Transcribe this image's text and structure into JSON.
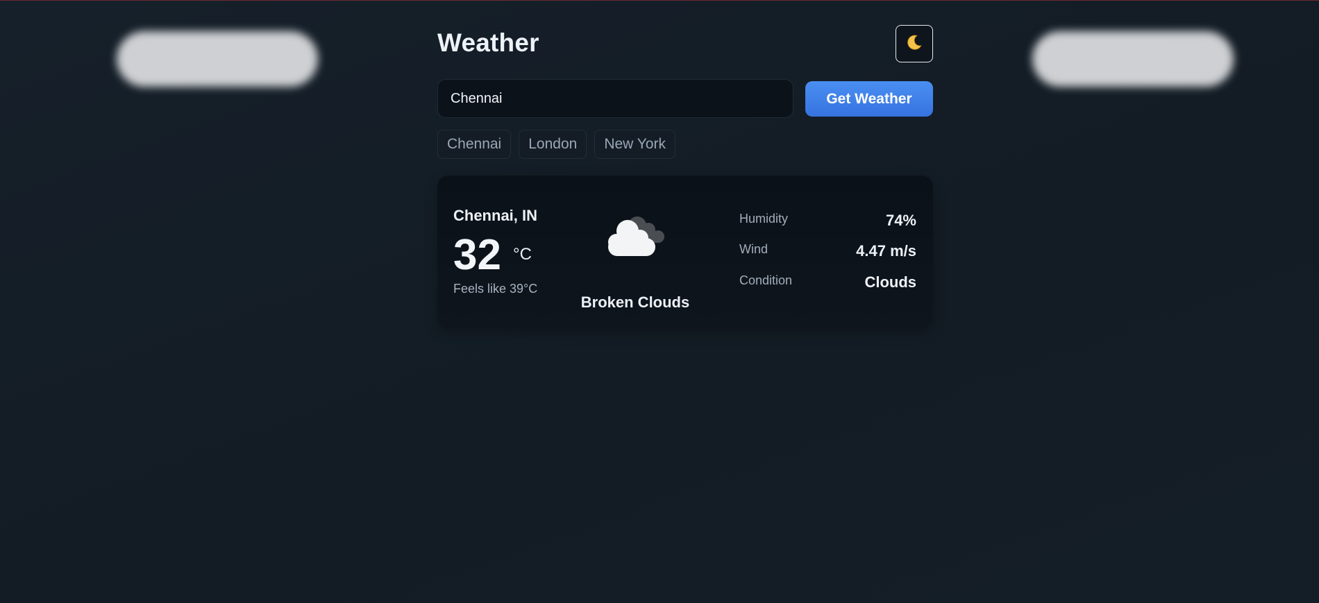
{
  "app": {
    "title": "Weather",
    "theme_toggle": {
      "icon": "moon-icon",
      "glyph": "🌙",
      "mode": "dark"
    }
  },
  "search": {
    "value": "Chennai",
    "placeholder": "",
    "button_label": "Get Weather"
  },
  "quick_cities": [
    {
      "label": "Chennai"
    },
    {
      "label": "London"
    },
    {
      "label": "New York"
    }
  ],
  "weather": {
    "location": "Chennai, IN",
    "temperature": "32",
    "unit": "°C",
    "feels_like": "Feels like 39°C",
    "icon": "broken-clouds-icon",
    "description": "Broken Clouds",
    "stats": [
      {
        "label": "Humidity",
        "value": "74%"
      },
      {
        "label": "Wind",
        "value": "4.47 m/s"
      },
      {
        "label": "Condition",
        "value": "Clouds"
      }
    ]
  },
  "colors": {
    "accent": "#3b82f6",
    "background": "#141e27",
    "card": "#0c1219",
    "blur_cloud": "#d4d6d9"
  }
}
